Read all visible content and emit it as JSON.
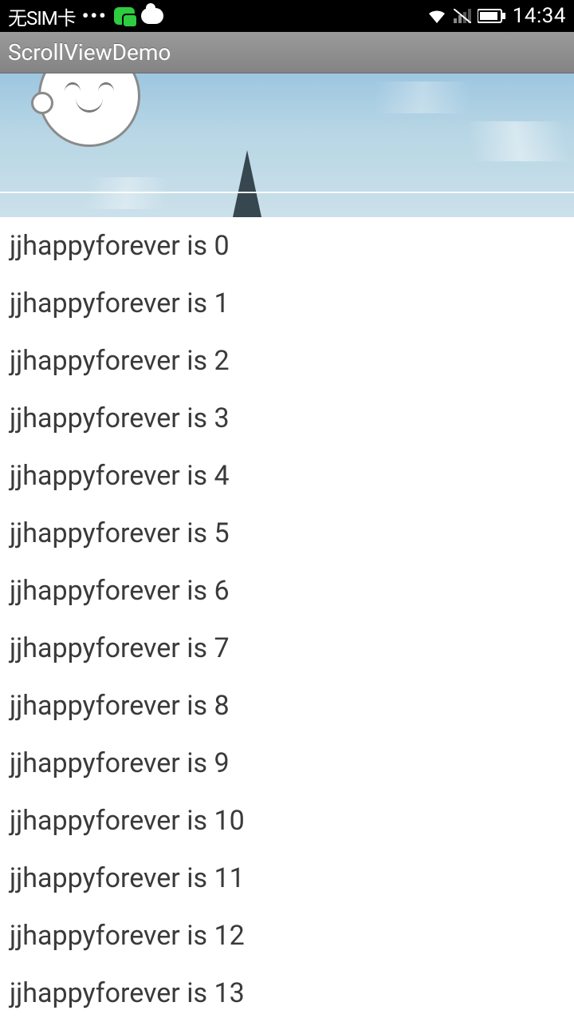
{
  "status": {
    "sim": "无SIM卡",
    "clock": "14:34"
  },
  "appbar": {
    "title": "ScrollViewDemo"
  },
  "list": {
    "items": [
      "jjhappyforever is 0",
      "jjhappyforever is 1",
      "jjhappyforever is 2",
      "jjhappyforever is 3",
      "jjhappyforever is 4",
      "jjhappyforever is 5",
      "jjhappyforever is 6",
      "jjhappyforever is 7",
      "jjhappyforever is 8",
      "jjhappyforever is 9",
      "jjhappyforever is 10",
      "jjhappyforever is 11",
      "jjhappyforever is 12",
      "jjhappyforever is 13"
    ]
  }
}
